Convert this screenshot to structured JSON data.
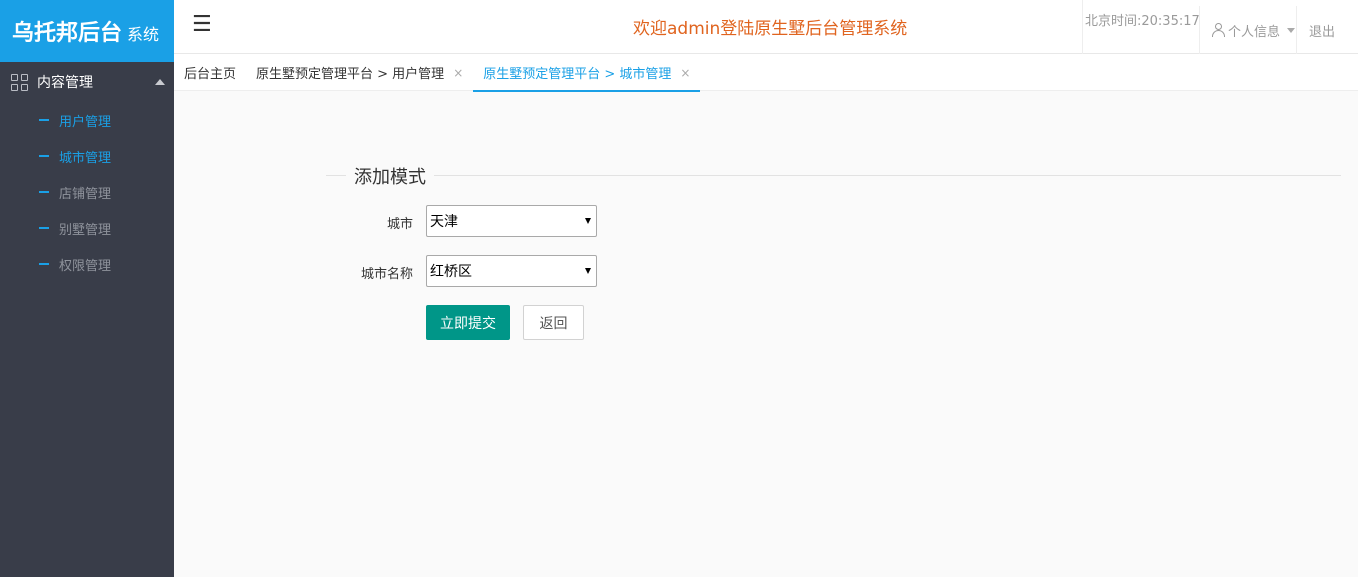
{
  "logo": {
    "main": "乌托邦后台",
    "sub": "系统"
  },
  "sidebar": {
    "group_label": "内容管理",
    "items": [
      {
        "label": "用户管理"
      },
      {
        "label": "城市管理"
      },
      {
        "label": "店铺管理"
      },
      {
        "label": "别墅管理"
      },
      {
        "label": "权限管理"
      }
    ]
  },
  "header": {
    "menu_glyph": "☰",
    "welcome": "欢迎admin登陆原生墅后台管理系统",
    "clock": "北京时间:20:35:17",
    "profile_label": "个人信息",
    "logout_label": "退出"
  },
  "tabs": [
    {
      "label": "后台主页",
      "closable": false
    },
    {
      "label": "原生墅预定管理平台 > 用户管理",
      "closable": true
    },
    {
      "label": "原生墅预定管理平台 > 城市管理",
      "closable": true,
      "active": true
    }
  ],
  "tab_close_glyph": "×",
  "form": {
    "legend": "添加模式",
    "city_label": "城市",
    "city_value": "天津",
    "city_name_label": "城市名称",
    "city_name_value": "红桥区",
    "submit_label": "立即提交",
    "back_label": "返回"
  },
  "colors": {
    "brand": "#1aa0e6",
    "sidebar_bg": "#393d49",
    "submit": "#009688",
    "welcome": "#e0641f"
  }
}
